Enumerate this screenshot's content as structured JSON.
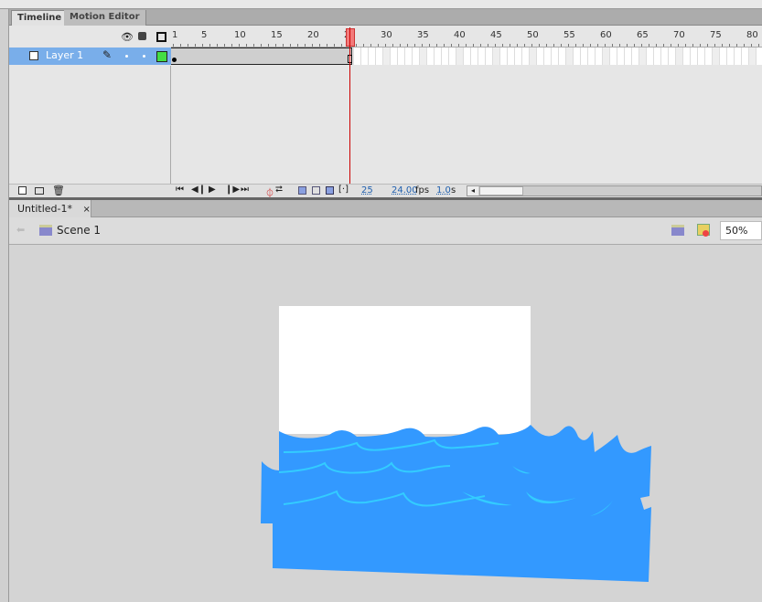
{
  "timeline": {
    "tabs": [
      {
        "label": "Timeline",
        "active": true
      },
      {
        "label": "Motion Editor",
        "active": false
      }
    ],
    "ruler_labels": [
      "1",
      "5",
      "10",
      "15",
      "20",
      "25",
      "30",
      "35",
      "40",
      "45",
      "50",
      "55",
      "60",
      "65",
      "70",
      "75",
      "80"
    ],
    "layers": [
      {
        "name": "Layer 1",
        "selected": true,
        "color": "#44dd44"
      }
    ],
    "current_frame": "25",
    "fps": "24.00",
    "fps_unit": "fps",
    "elapsed": "1.0",
    "elapsed_unit": "s",
    "header_icons": [
      "eye-icon",
      "lock-icon",
      "outline-icon"
    ],
    "bottom_icons": [
      "new-layer-icon",
      "new-folder-icon",
      "delete-icon",
      "first-frame-icon",
      "step-back-icon",
      "play-icon",
      "step-forward-icon",
      "last-frame-icon",
      "center-frame-icon",
      "loop-icon",
      "onion-skin-icon",
      "onion-outline-icon",
      "edit-multiple-icon",
      "onion-markers-icon"
    ]
  },
  "document": {
    "tab_label": "Untitled-1*",
    "close": "×",
    "scene": "Scene 1",
    "zoom": "50%"
  },
  "colors": {
    "water": "#3399ff",
    "wave_highlight": "#33ccff",
    "stage": "#ffffff",
    "accent": "#cc0000"
  }
}
